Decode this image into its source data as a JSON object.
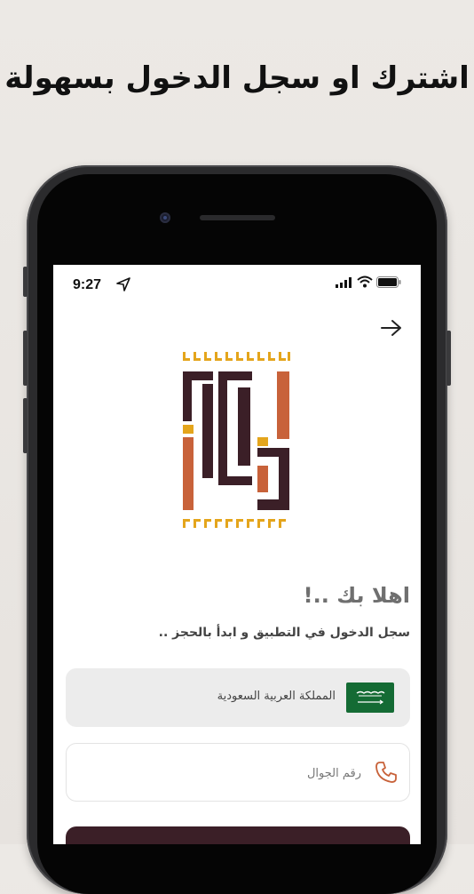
{
  "headline": "اشترك او سجل الدخول بسهولة",
  "status_bar": {
    "time": "9:27"
  },
  "welcome": {
    "title": "اهلا بك ..!",
    "subtitle": "سجل الدخول في التطبيق و ابدأ بالحجز .."
  },
  "country_field": {
    "name": "المملكة العربية السعودية",
    "flag_icon": "saudi-flag-icon"
  },
  "phone_field": {
    "placeholder": "رقم الجوال",
    "value": ""
  },
  "colors": {
    "brand_dark": "#3b1f27",
    "brand_orange": "#c8623a",
    "brand_yellow": "#e4a51c",
    "flag_green": "#146b34"
  }
}
